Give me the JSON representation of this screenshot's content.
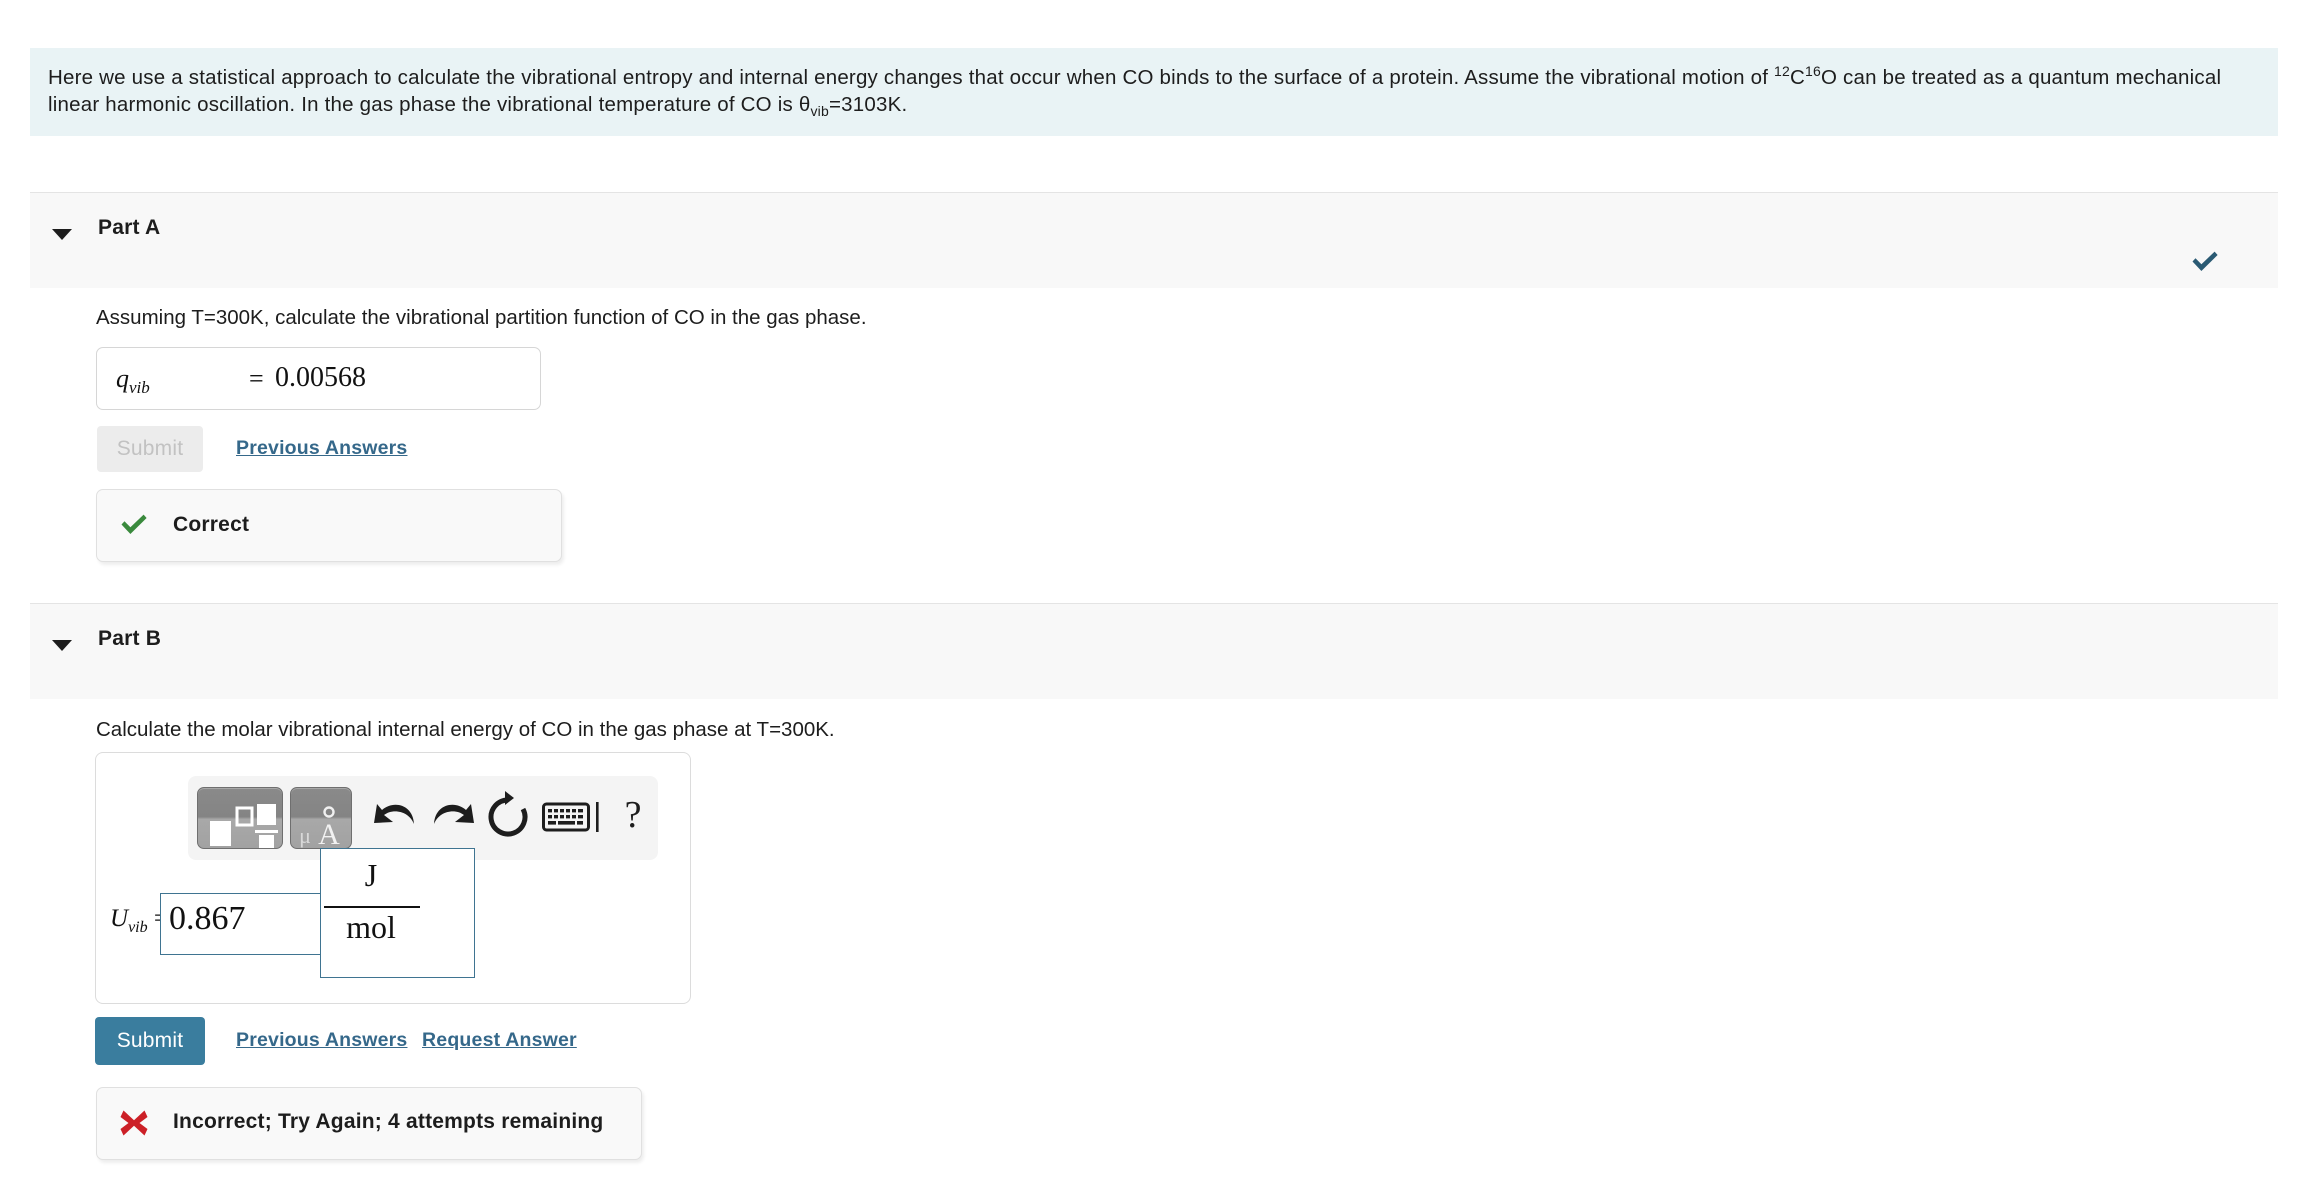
{
  "intro": {
    "line1_a": "Here we use a statistical approach to calculate the vibrational entropy and internal energy changes that occur when CO binds to the surface of a protein. Assume the vibrational motion of ",
    "iso_c_sup": "12",
    "iso_c": "C",
    "iso_o_sup": "16",
    "iso_o": "O",
    "line1_b": " can be treated as a quantum mechanical",
    "line2_a": "linear harmonic oscillation. In the gas phase the vibrational temperature of CO is ",
    "theta_sym": "θ",
    "theta_sub": "vib",
    "line2_b": "=3103K.",
    "bg_color": "#e9f3f5"
  },
  "part_a": {
    "label": "Part A",
    "caret_icon": "caret-down-icon",
    "status_check_icon": "check-icon",
    "status_check_color": "#2a5a73",
    "question": "Assuming T=300K, calculate the vibrational partition function of CO in the gas phase.",
    "answer": {
      "variable": "q",
      "subscript": "vib",
      "equals": "=",
      "value": "0.00568"
    },
    "submit_label": "Submit",
    "submit_enabled": false,
    "previous_answers_label": "Previous Answers",
    "feedback": {
      "icon": "check-icon",
      "icon_color": "#3a8a3d",
      "text": "Correct"
    }
  },
  "part_b": {
    "label": "Part B",
    "caret_icon": "caret-down-icon",
    "question": "Calculate the molar vibrational internal energy of CO in the gas phase at T=300K.",
    "toolbar": {
      "templates_button": "math-templates-icon",
      "units_button": "units-angstrom-icon",
      "units_button_text": "μÅ",
      "undo_button": "undo-icon",
      "redo_button": "redo-icon",
      "reset_button": "reset-icon",
      "keyboard_button": "keyboard-icon",
      "help_button": "?"
    },
    "answer": {
      "variable": "U",
      "subscript": "vib",
      "equals": "=",
      "value": "0.867",
      "units_numerator": "J",
      "units_denominator": "mol"
    },
    "submit_label": "Submit",
    "submit_enabled": true,
    "previous_answers_label": "Previous Answers",
    "request_answer_label": "Request Answer",
    "feedback": {
      "icon": "x-icon",
      "icon_color": "#cc2027",
      "text": "Incorrect; Try Again; 4 attempts remaining"
    }
  }
}
